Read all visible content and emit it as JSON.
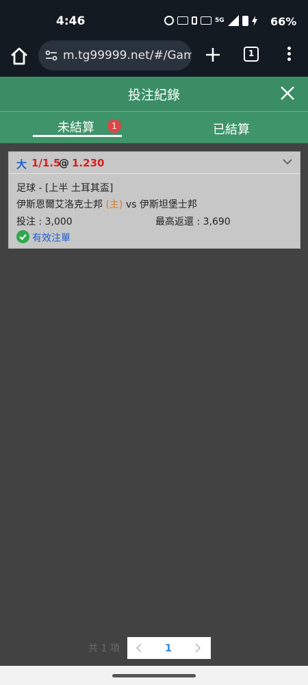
{
  "status_bar": {
    "time": "4:46",
    "network_label": "5G",
    "battery_percent": "66%",
    "icons": [
      "alarm-icon",
      "auto-icon",
      "vibrate-icon",
      "lte-icon",
      "5g-icon",
      "signal-icon",
      "battery-icon",
      "charging-icon"
    ]
  },
  "browser": {
    "url": "m.tg99999.net/#/Gam",
    "tab_count": "1",
    "icons": [
      "home-icon",
      "site-settings-icon",
      "plus-icon",
      "tabs-icon",
      "more-menu-icon"
    ]
  },
  "header": {
    "title": "投注紀錄",
    "close_icon": "close-icon"
  },
  "tabs": [
    {
      "label": "未結算",
      "badge": "1",
      "active": true
    },
    {
      "label": "已結算",
      "active": false
    }
  ],
  "bet": {
    "side": "大",
    "line": "1/1.5",
    "at": "@",
    "odds": "1.230",
    "league": "足球 - [上半 土耳其盃]",
    "home_team": "伊斯恩爾艾洛克士邦",
    "home_tag": "(主)",
    "vs": "vs",
    "away_team": "伊斯坦堡士邦",
    "stake": "投注 : 3,000",
    "max_return": "最高返還 : 3,690",
    "status": "有效注單"
  },
  "pagination": {
    "total": "共 1 項",
    "current_page": "1"
  },
  "colors": {
    "header_green": "#3a8d65",
    "tab_green": "#3f9469",
    "badge_red": "#d94747",
    "odds_red": "#d42020",
    "link_blue": "#1d5fd0",
    "check_green": "#2ea84a",
    "home_orange": "#e07a1c",
    "page_bg": "#424242"
  }
}
